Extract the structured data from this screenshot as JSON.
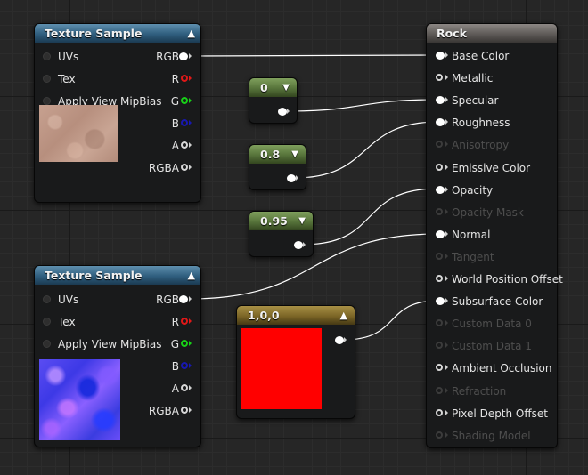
{
  "colors": {
    "swatch": "#ff0000",
    "wire": "#ffffff"
  },
  "texture_sample_1": {
    "title": "Texture Sample",
    "inputs": [
      "UVs",
      "Tex",
      "Apply View MipBias"
    ],
    "outputs": [
      "RGB",
      "R",
      "G",
      "B",
      "A",
      "RGBA"
    ],
    "preview_icon": "rock-texture-thumbnail"
  },
  "texture_sample_2": {
    "title": "Texture Sample",
    "inputs": [
      "UVs",
      "Tex",
      "Apply View MipBias"
    ],
    "outputs": [
      "RGB",
      "R",
      "G",
      "B",
      "A",
      "RGBA"
    ],
    "preview_icon": "normal-map-thumbnail"
  },
  "constant_specular": {
    "value": "0"
  },
  "constant_roughness": {
    "value": "0.8"
  },
  "constant_opacity": {
    "value": "0.95"
  },
  "vector_constant": {
    "value": "1,0,0"
  },
  "material": {
    "title": "Rock",
    "pins": [
      {
        "label": "Base Color",
        "state": "connected"
      },
      {
        "label": "Metallic",
        "state": "available"
      },
      {
        "label": "Specular",
        "state": "connected"
      },
      {
        "label": "Roughness",
        "state": "connected"
      },
      {
        "label": "Anisotropy",
        "state": "disabled"
      },
      {
        "label": "Emissive Color",
        "state": "available"
      },
      {
        "label": "Opacity",
        "state": "connected"
      },
      {
        "label": "Opacity Mask",
        "state": "disabled"
      },
      {
        "label": "Normal",
        "state": "connected"
      },
      {
        "label": "Tangent",
        "state": "disabled"
      },
      {
        "label": "World Position Offset",
        "state": "available"
      },
      {
        "label": "Subsurface Color",
        "state": "connected"
      },
      {
        "label": "Custom Data 0",
        "state": "disabled"
      },
      {
        "label": "Custom Data 1",
        "state": "disabled"
      },
      {
        "label": "Ambient Occlusion",
        "state": "available"
      },
      {
        "label": "Refraction",
        "state": "disabled"
      },
      {
        "label": "Pixel Depth Offset",
        "state": "available"
      },
      {
        "label": "Shading Model",
        "state": "disabled"
      }
    ]
  }
}
